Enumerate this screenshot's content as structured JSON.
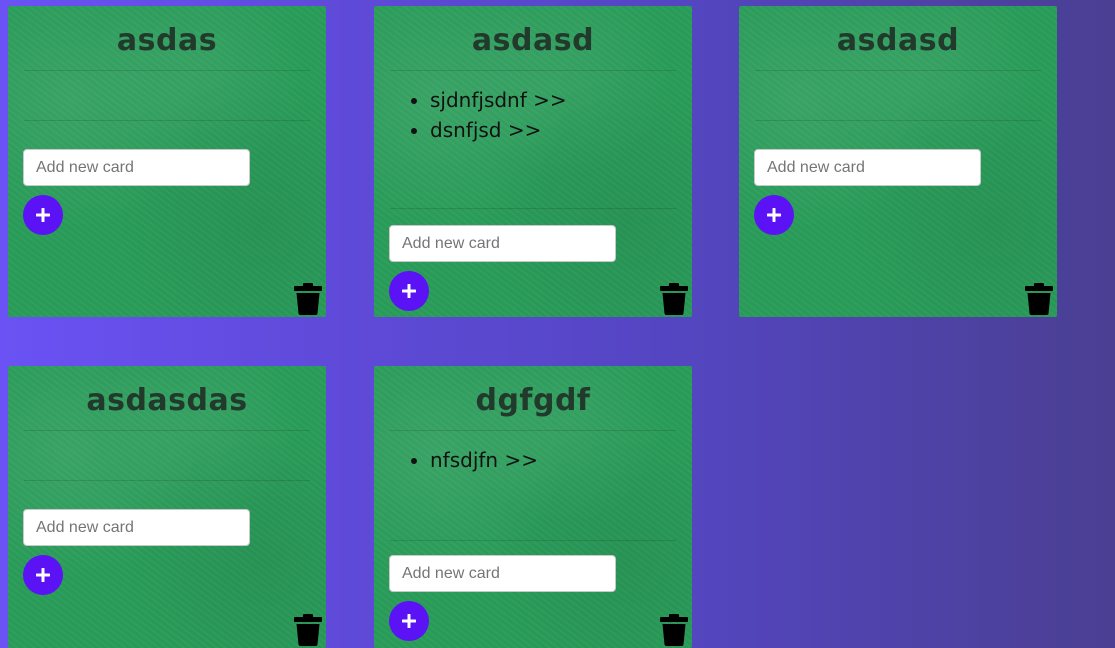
{
  "input_placeholder": "Add new card",
  "icons": {
    "add": "plus-icon",
    "delete": "trash-icon"
  },
  "colors": {
    "board_bg": "#2a9d5a",
    "add_button": "#5b12f5"
  },
  "boards": [
    {
      "title": "asdas",
      "cards": []
    },
    {
      "title": "asdasd",
      "cards": [
        "sjdnfjsdnf >>",
        "dsnfjsd >>"
      ]
    },
    {
      "title": "asdasd",
      "cards": []
    },
    {
      "title": "asdasdas",
      "cards": []
    },
    {
      "title": "dgfgdf",
      "cards": [
        "nfsdjfn >>"
      ]
    }
  ]
}
